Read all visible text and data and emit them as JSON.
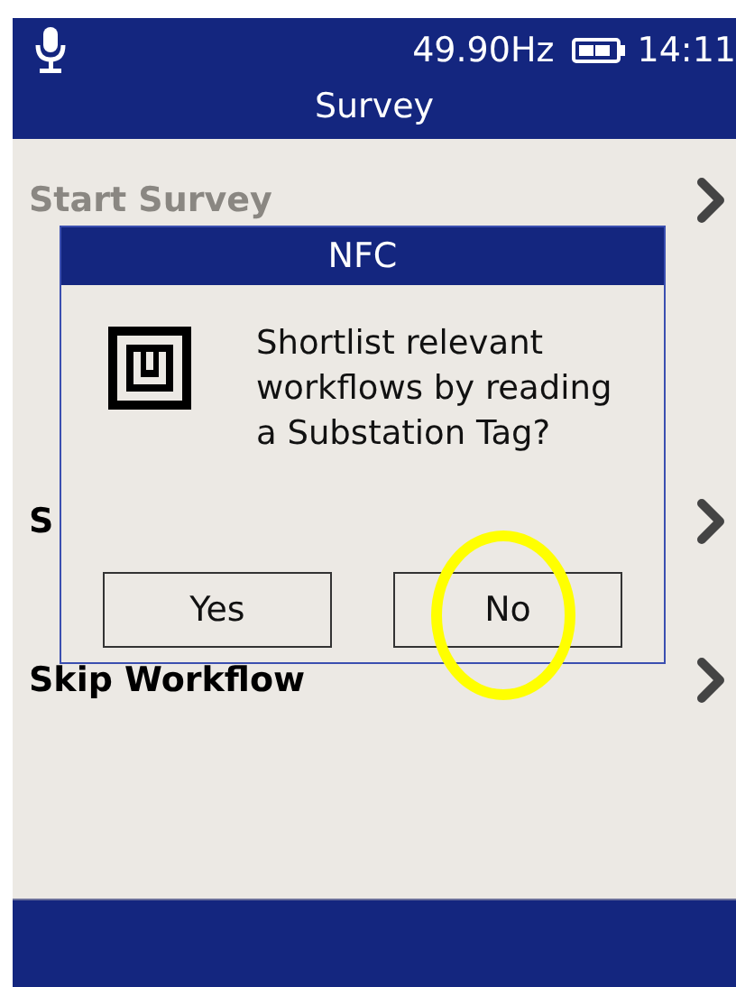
{
  "status_bar": {
    "frequency": "49.90Hz",
    "time": "14:11"
  },
  "header": {
    "title": "Survey"
  },
  "menu": {
    "items": [
      {
        "label": "Start Survey",
        "disabled": true
      },
      {
        "label": "S",
        "disabled": false
      },
      {
        "label": "Skip Workflow",
        "disabled": false
      }
    ]
  },
  "dialog": {
    "title": "NFC",
    "message": "Shortlist relevant workflows by reading a Substation Tag?",
    "buttons": [
      {
        "label": "Yes",
        "highlighted": false
      },
      {
        "label": "No",
        "highlighted": true
      }
    ]
  }
}
